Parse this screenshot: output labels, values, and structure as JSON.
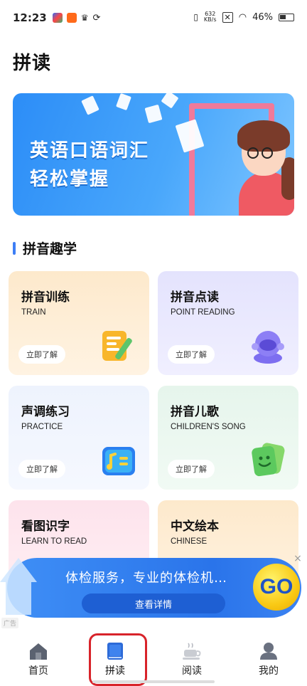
{
  "status_bar": {
    "time": "12:23",
    "net_speed": "632\nKB/s",
    "battery": "46%"
  },
  "page": {
    "title": "拼读"
  },
  "banner": {
    "line1": "英语口语词汇",
    "line2": "轻松掌握"
  },
  "section": {
    "title": "拼音趣学"
  },
  "cards": [
    {
      "title": "拼音训练",
      "subtitle": "TRAIN",
      "button": "立即了解",
      "icon": "notebook-pencil-icon"
    },
    {
      "title": "拼音点读",
      "subtitle": "POINT READING",
      "button": "立即了解",
      "icon": "robot-speaker-icon"
    },
    {
      "title": "声调练习",
      "subtitle": "PRACTICE",
      "button": "立即了解",
      "icon": "music-note-board-icon"
    },
    {
      "title": "拼音儿歌",
      "subtitle": "CHILDREN'S SONG",
      "button": "立即了解",
      "icon": "smile-cards-icon"
    },
    {
      "title": "看图识字",
      "subtitle": "LEARN TO READ",
      "button": "",
      "icon": ""
    },
    {
      "title": "中文绘本",
      "subtitle": "CHINESE",
      "button": "",
      "icon": ""
    }
  ],
  "ad": {
    "text": "体检服务，专业的体检机…",
    "cta": "查看详情",
    "go_label": "GO",
    "close": "×",
    "tag": "广告"
  },
  "tab_bar": {
    "tabs": [
      {
        "label": "首页",
        "icon": "home-icon"
      },
      {
        "label": "拼读",
        "icon": "book-icon"
      },
      {
        "label": "阅读",
        "icon": "coffee-cup-icon"
      },
      {
        "label": "我的",
        "icon": "profile-icon"
      }
    ],
    "active_index": 1
  },
  "colors": {
    "accent": "#3d7ef5",
    "highlight_ring": "#d8232a"
  }
}
